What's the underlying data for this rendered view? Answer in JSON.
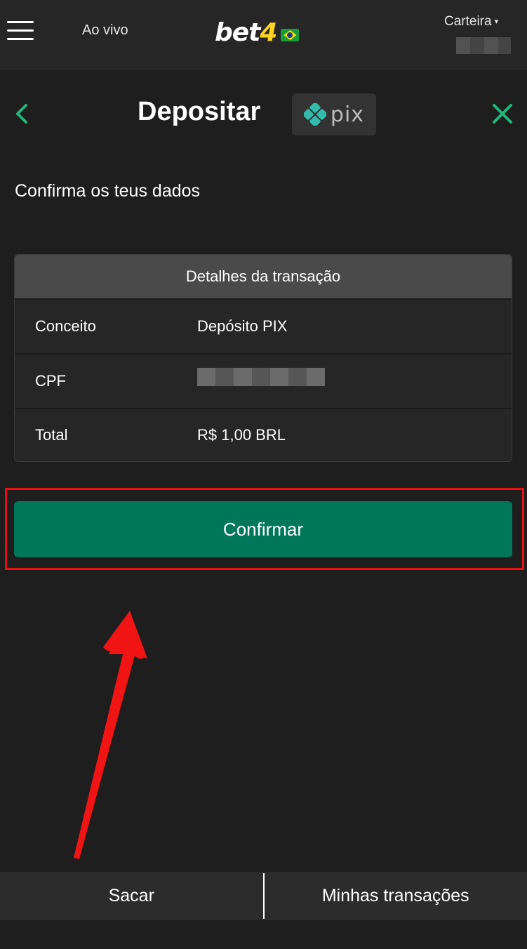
{
  "topbar": {
    "live_label": "Ao vivo",
    "logo_text_main": "bet",
    "logo_text_number": "4",
    "wallet_label": "Carteira",
    "wallet_caret": "▾"
  },
  "deposit": {
    "title": "Depositar",
    "payment_method": "pix",
    "subtitle": "Confirma os teus dados"
  },
  "transaction": {
    "header": "Detalhes da transação",
    "rows": [
      {
        "label": "Conceito",
        "value": "Depósito PIX"
      },
      {
        "label": "CPF",
        "value": ""
      },
      {
        "label": "Total",
        "value": "R$ 1,00 BRL"
      }
    ]
  },
  "actions": {
    "confirm_label": "Confirmar"
  },
  "bottom_nav": {
    "withdraw_label": "Sacar",
    "transactions_label": "Minhas transações"
  },
  "colors": {
    "accent_green": "#00765a",
    "icon_green": "#23b67b",
    "highlight_red": "#e51212",
    "logo_yellow": "#ffd21f"
  }
}
